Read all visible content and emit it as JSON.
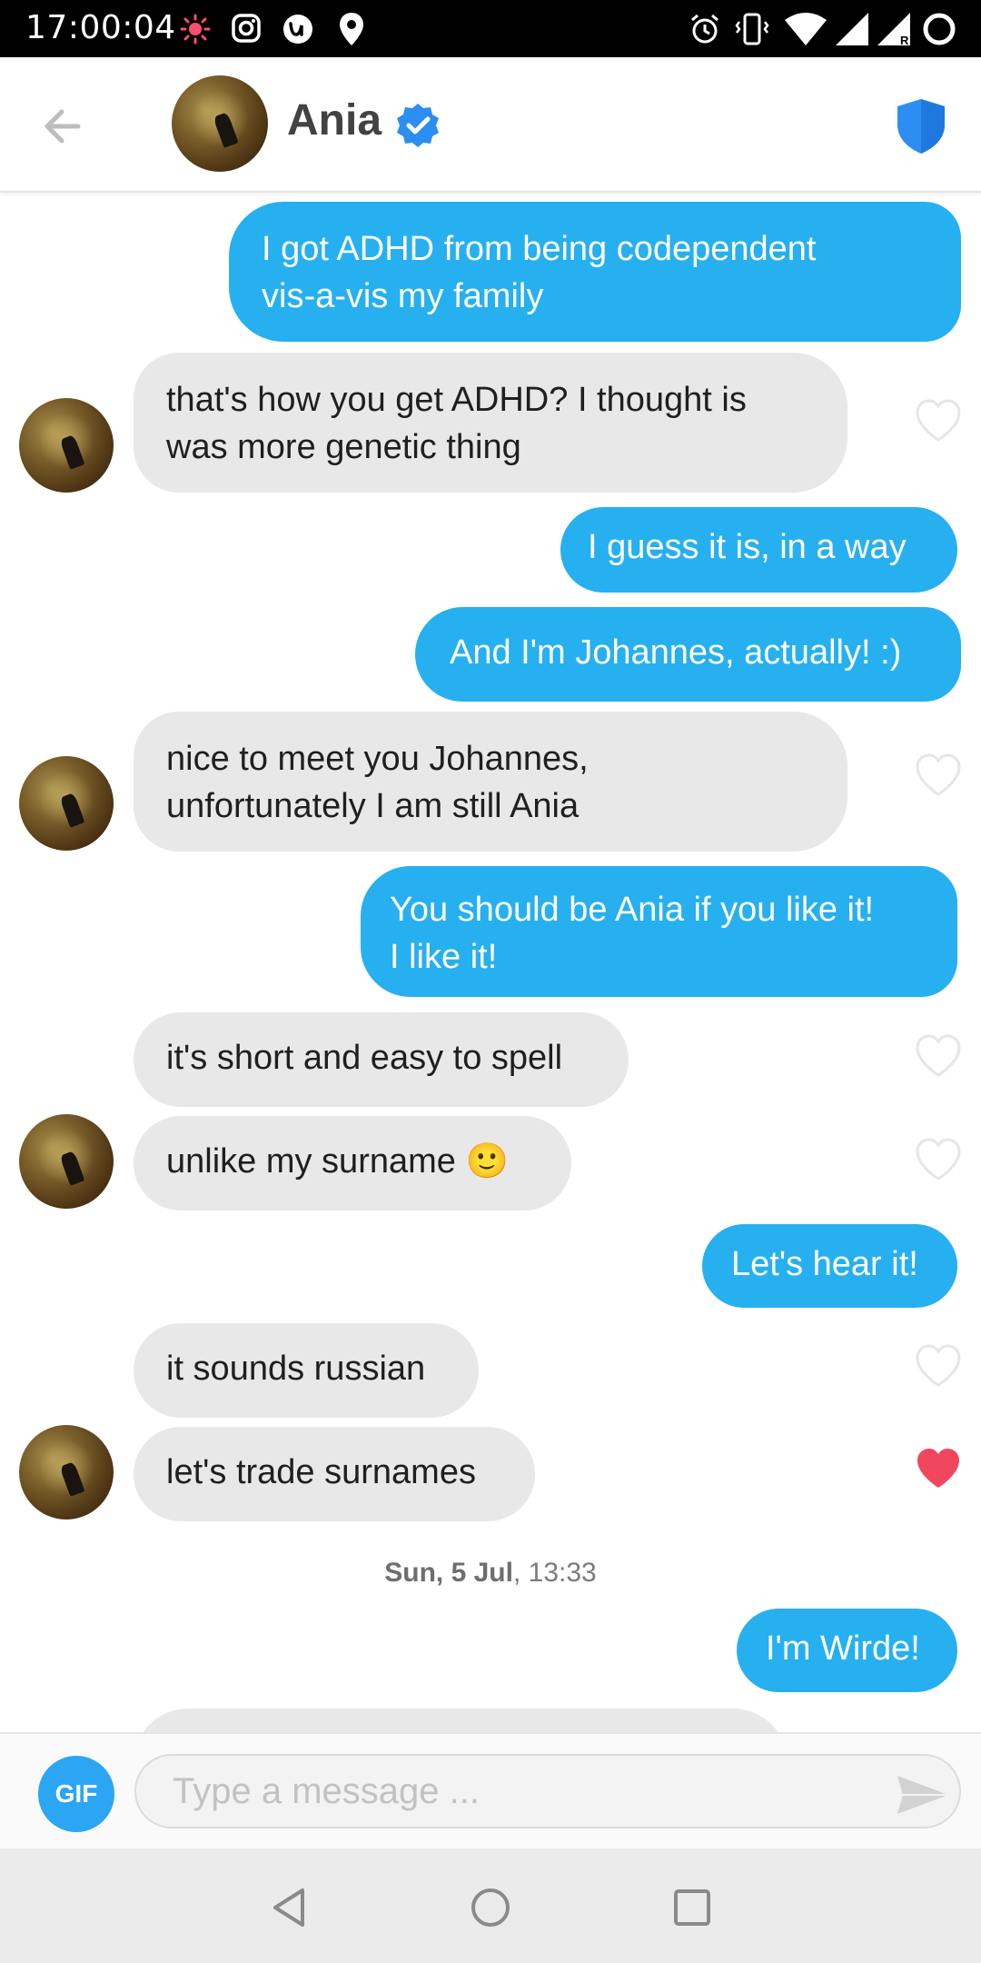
{
  "status_bar": {
    "time": "17:00:04"
  },
  "header": {
    "name": "Ania"
  },
  "messages": [
    {
      "side": "sent",
      "text": "I got ADHD from being codependent\nvis-a-vis my family"
    },
    {
      "side": "recv",
      "text": "that's how you get ADHD? I thought is\nwas more genetic thing",
      "liked": false
    },
    {
      "side": "sent",
      "text": "I guess it is, in a way"
    },
    {
      "side": "sent",
      "text": "And I'm Johannes, actually! :)"
    },
    {
      "side": "recv",
      "text": "nice to meet you Johannes,\nunfortunately I am still Ania",
      "liked": false
    },
    {
      "side": "sent",
      "text": "You should be Ania if you like it!\nI like it!"
    },
    {
      "side": "recv",
      "text": "it's short and easy to spell",
      "liked": false
    },
    {
      "side": "recv",
      "text": "unlike my surname 🙂",
      "liked": false
    },
    {
      "side": "sent",
      "text": "Let's hear it!"
    },
    {
      "side": "recv",
      "text": "it sounds russian",
      "liked": false
    },
    {
      "side": "recv",
      "text": "let's trade surnames",
      "liked": true
    },
    {
      "side": "sent",
      "text": "I'm Wirde!"
    }
  ],
  "timestamp": {
    "day": "Sun, 5 Jul",
    "time": ", 13:33"
  },
  "composer": {
    "gif_label": "GIF",
    "placeholder": "Type a message ..."
  },
  "colors": {
    "sent_bubble": "#26b0f0",
    "received_bubble": "#e8e8e8",
    "like_active": "#f0475f",
    "accent": "#2b8ef0"
  }
}
